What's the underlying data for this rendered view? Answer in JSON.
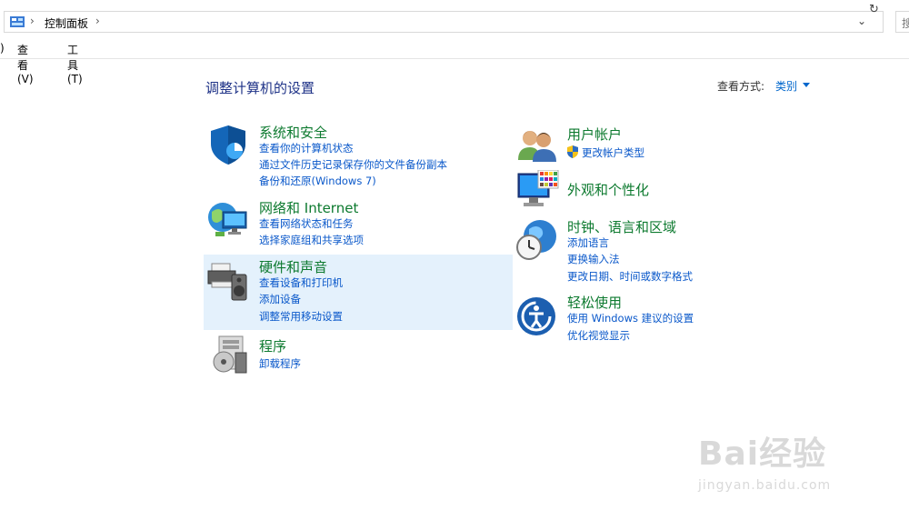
{
  "addressbar": {
    "breadcrumb": "控制面板",
    "separator": "›",
    "dropdown_glyph": "⌄",
    "refresh_glyph": "↻",
    "search_placeholder": "搜"
  },
  "menubar": {
    "items": [
      ")",
      "查看(V)",
      "工具(T)"
    ]
  },
  "header": {
    "title": "调整计算机的设置",
    "view_by_label": "查看方式:",
    "view_by_value": "类别"
  },
  "categories": {
    "system": {
      "title": "系统和安全",
      "links": [
        "查看你的计算机状态",
        "通过文件历史记录保存你的文件备份副本",
        "备份和还原(Windows 7)"
      ]
    },
    "network": {
      "title": "网络和 Internet",
      "links": [
        "查看网络状态和任务",
        "选择家庭组和共享选项"
      ]
    },
    "hardware": {
      "title": "硬件和声音",
      "links": [
        "查看设备和打印机",
        "添加设备",
        "调整常用移动设置"
      ]
    },
    "programs": {
      "title": "程序",
      "links": [
        "卸载程序"
      ]
    },
    "users": {
      "title": "用户帐户",
      "links": [
        "更改帐户类型"
      ]
    },
    "appearance": {
      "title": "外观和个性化",
      "links": []
    },
    "clock": {
      "title": "时钟、语言和区域",
      "links": [
        "添加语言",
        "更换输入法",
        "更改日期、时间或数字格式"
      ]
    },
    "ease": {
      "title": "轻松使用",
      "links": [
        "使用 Windows 建议的设置",
        "优化视觉显示"
      ]
    }
  },
  "watermark": {
    "logo_text": "Bai经验",
    "url": "jingyan.baidu.com"
  },
  "colors": {
    "heading": "#0d7a2f",
    "link": "#0a58ca",
    "title": "#1e3287",
    "highlight": "#e4f1fc"
  }
}
